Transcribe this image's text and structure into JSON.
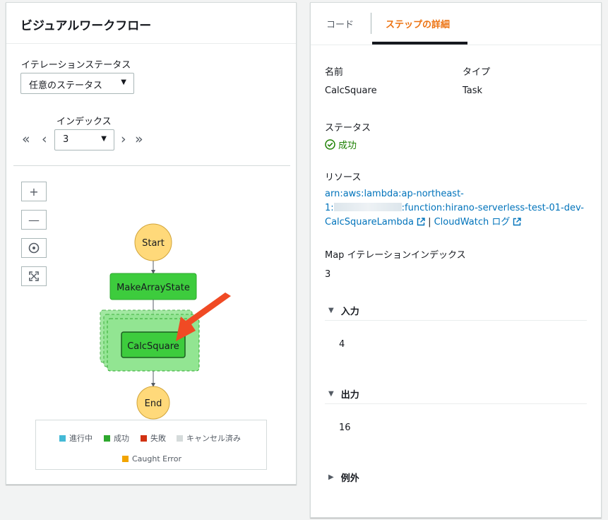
{
  "left": {
    "title": "ビジュアルワークフロー",
    "iteration_status_label": "イテレーションステータス",
    "iteration_status_value": "任意のステータス",
    "index_label": "インデックス",
    "index_value": "3",
    "nav": {
      "first": "«",
      "prev": "‹",
      "next": "›",
      "last": "»"
    },
    "zoom": {
      "in": "+",
      "out": "—",
      "center_icon": "target-icon",
      "fit_icon": "expand-icon"
    },
    "graph": {
      "start": "Start",
      "make_array": "MakeArrayState",
      "calc_square": "CalcSquare",
      "end": "End"
    },
    "legend": [
      {
        "label": "進行中",
        "color": "#44b9d6"
      },
      {
        "label": "成功",
        "color": "#2ea82e"
      },
      {
        "label": "失敗",
        "color": "#d13212"
      },
      {
        "label": "キャンセル済み",
        "color": "#d5dbdb"
      },
      {
        "label": "Caught Error",
        "color": "#f2a400"
      }
    ]
  },
  "right": {
    "tabs": {
      "code": "コード",
      "details": "ステップの詳細"
    },
    "name_label": "名前",
    "name_value": "CalcSquare",
    "type_label": "タイプ",
    "type_value": "Task",
    "status_label": "ステータス",
    "status_value": "成功",
    "resource_label": "リソース",
    "resource_line1": "arn:aws:lambda:ap-northeast-",
    "resource_line2_prefix": "1:",
    "resource_line2_suffix": ":function:hirano-serverless-test-01-dev-",
    "resource_line3": "CalcSquareLambda",
    "separator": "|",
    "cloudwatch_link": "CloudWatch ログ",
    "map_index_label": "Map イテレーションインデックス",
    "map_index_value": "3",
    "input_label": "入力",
    "input_value": "4",
    "output_label": "出力",
    "output_value": "16",
    "exception_label": "例外"
  },
  "colors": {
    "accent": "#ec7211",
    "link": "#0073bb",
    "success_node": "#3dcc3d",
    "terminal_node": "#ffd97a",
    "arrow": "#f04a24"
  }
}
